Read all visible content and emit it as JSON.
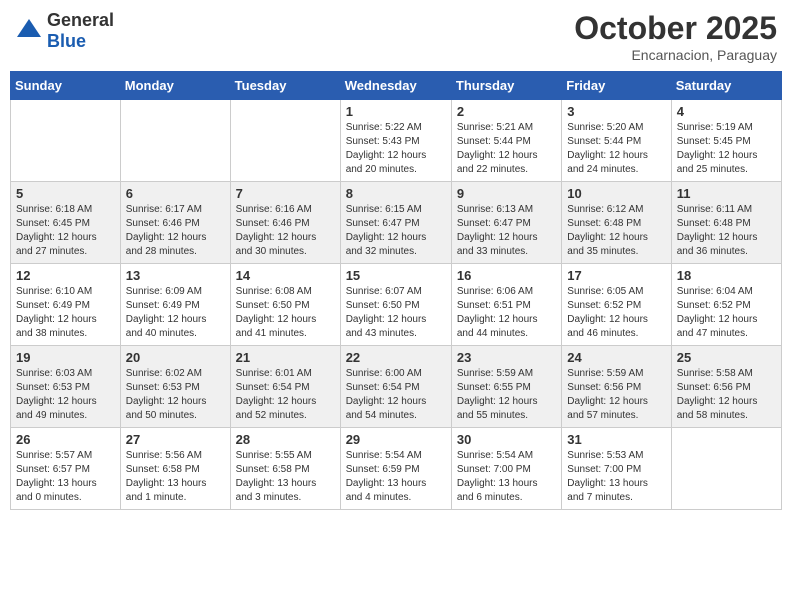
{
  "header": {
    "logo": {
      "general": "General",
      "blue": "Blue"
    },
    "title": "October 2025",
    "location": "Encarnacion, Paraguay"
  },
  "weekdays": [
    "Sunday",
    "Monday",
    "Tuesday",
    "Wednesday",
    "Thursday",
    "Friday",
    "Saturday"
  ],
  "weeks": [
    [
      {
        "day": "",
        "info": ""
      },
      {
        "day": "",
        "info": ""
      },
      {
        "day": "",
        "info": ""
      },
      {
        "day": "1",
        "info": "Sunrise: 5:22 AM\nSunset: 5:43 PM\nDaylight: 12 hours\nand 20 minutes."
      },
      {
        "day": "2",
        "info": "Sunrise: 5:21 AM\nSunset: 5:44 PM\nDaylight: 12 hours\nand 22 minutes."
      },
      {
        "day": "3",
        "info": "Sunrise: 5:20 AM\nSunset: 5:44 PM\nDaylight: 12 hours\nand 24 minutes."
      },
      {
        "day": "4",
        "info": "Sunrise: 5:19 AM\nSunset: 5:45 PM\nDaylight: 12 hours\nand 25 minutes."
      }
    ],
    [
      {
        "day": "5",
        "info": "Sunrise: 6:18 AM\nSunset: 6:45 PM\nDaylight: 12 hours\nand 27 minutes."
      },
      {
        "day": "6",
        "info": "Sunrise: 6:17 AM\nSunset: 6:46 PM\nDaylight: 12 hours\nand 28 minutes."
      },
      {
        "day": "7",
        "info": "Sunrise: 6:16 AM\nSunset: 6:46 PM\nDaylight: 12 hours\nand 30 minutes."
      },
      {
        "day": "8",
        "info": "Sunrise: 6:15 AM\nSunset: 6:47 PM\nDaylight: 12 hours\nand 32 minutes."
      },
      {
        "day": "9",
        "info": "Sunrise: 6:13 AM\nSunset: 6:47 PM\nDaylight: 12 hours\nand 33 minutes."
      },
      {
        "day": "10",
        "info": "Sunrise: 6:12 AM\nSunset: 6:48 PM\nDaylight: 12 hours\nand 35 minutes."
      },
      {
        "day": "11",
        "info": "Sunrise: 6:11 AM\nSunset: 6:48 PM\nDaylight: 12 hours\nand 36 minutes."
      }
    ],
    [
      {
        "day": "12",
        "info": "Sunrise: 6:10 AM\nSunset: 6:49 PM\nDaylight: 12 hours\nand 38 minutes."
      },
      {
        "day": "13",
        "info": "Sunrise: 6:09 AM\nSunset: 6:49 PM\nDaylight: 12 hours\nand 40 minutes."
      },
      {
        "day": "14",
        "info": "Sunrise: 6:08 AM\nSunset: 6:50 PM\nDaylight: 12 hours\nand 41 minutes."
      },
      {
        "day": "15",
        "info": "Sunrise: 6:07 AM\nSunset: 6:50 PM\nDaylight: 12 hours\nand 43 minutes."
      },
      {
        "day": "16",
        "info": "Sunrise: 6:06 AM\nSunset: 6:51 PM\nDaylight: 12 hours\nand 44 minutes."
      },
      {
        "day": "17",
        "info": "Sunrise: 6:05 AM\nSunset: 6:52 PM\nDaylight: 12 hours\nand 46 minutes."
      },
      {
        "day": "18",
        "info": "Sunrise: 6:04 AM\nSunset: 6:52 PM\nDaylight: 12 hours\nand 47 minutes."
      }
    ],
    [
      {
        "day": "19",
        "info": "Sunrise: 6:03 AM\nSunset: 6:53 PM\nDaylight: 12 hours\nand 49 minutes."
      },
      {
        "day": "20",
        "info": "Sunrise: 6:02 AM\nSunset: 6:53 PM\nDaylight: 12 hours\nand 50 minutes."
      },
      {
        "day": "21",
        "info": "Sunrise: 6:01 AM\nSunset: 6:54 PM\nDaylight: 12 hours\nand 52 minutes."
      },
      {
        "day": "22",
        "info": "Sunrise: 6:00 AM\nSunset: 6:54 PM\nDaylight: 12 hours\nand 54 minutes."
      },
      {
        "day": "23",
        "info": "Sunrise: 5:59 AM\nSunset: 6:55 PM\nDaylight: 12 hours\nand 55 minutes."
      },
      {
        "day": "24",
        "info": "Sunrise: 5:59 AM\nSunset: 6:56 PM\nDaylight: 12 hours\nand 57 minutes."
      },
      {
        "day": "25",
        "info": "Sunrise: 5:58 AM\nSunset: 6:56 PM\nDaylight: 12 hours\nand 58 minutes."
      }
    ],
    [
      {
        "day": "26",
        "info": "Sunrise: 5:57 AM\nSunset: 6:57 PM\nDaylight: 13 hours\nand 0 minutes."
      },
      {
        "day": "27",
        "info": "Sunrise: 5:56 AM\nSunset: 6:58 PM\nDaylight: 13 hours\nand 1 minute."
      },
      {
        "day": "28",
        "info": "Sunrise: 5:55 AM\nSunset: 6:58 PM\nDaylight: 13 hours\nand 3 minutes."
      },
      {
        "day": "29",
        "info": "Sunrise: 5:54 AM\nSunset: 6:59 PM\nDaylight: 13 hours\nand 4 minutes."
      },
      {
        "day": "30",
        "info": "Sunrise: 5:54 AM\nSunset: 7:00 PM\nDaylight: 13 hours\nand 6 minutes."
      },
      {
        "day": "31",
        "info": "Sunrise: 5:53 AM\nSunset: 7:00 PM\nDaylight: 13 hours\nand 7 minutes."
      },
      {
        "day": "",
        "info": ""
      }
    ]
  ]
}
